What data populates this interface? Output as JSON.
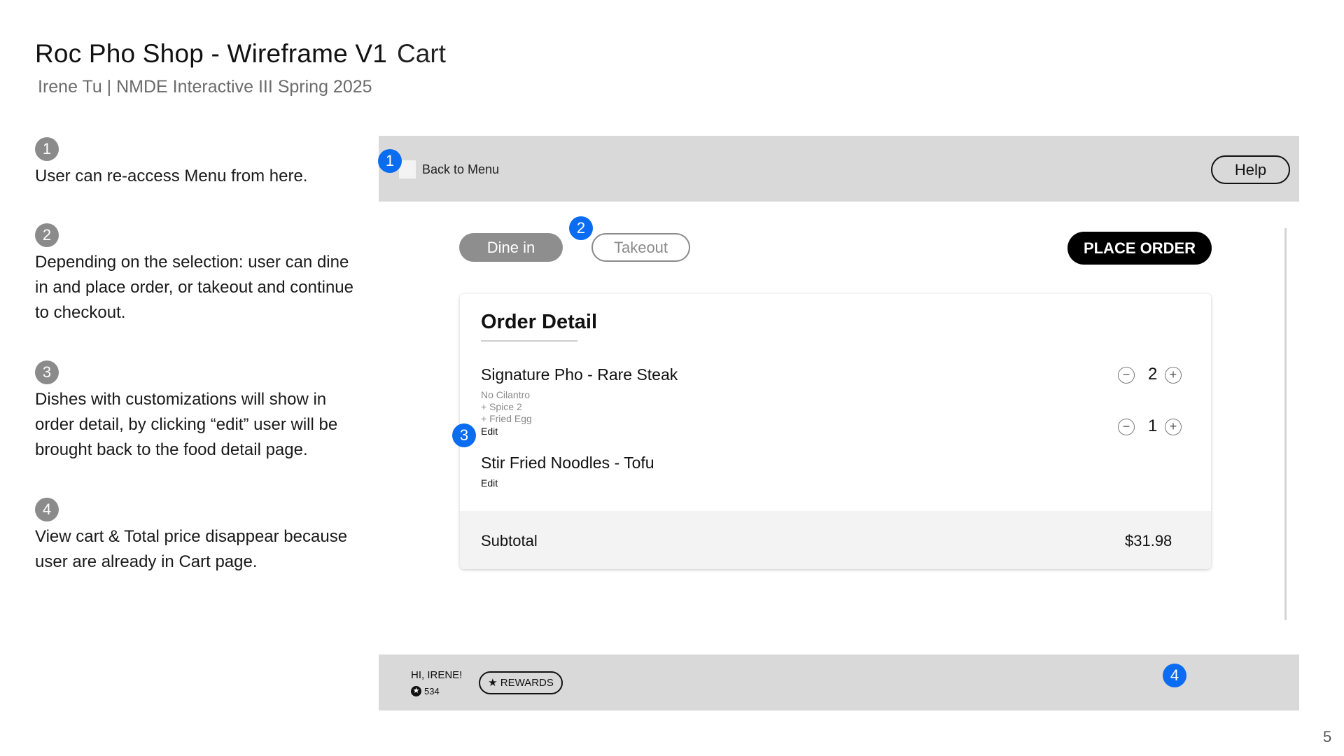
{
  "header": {
    "title": "Roc Pho Shop - Wireframe V1",
    "page_name": "Cart",
    "subtitle": "Irene Tu | NMDE Interactive III Spring 2025"
  },
  "notes": [
    {
      "num": "1",
      "text": "User can re-access Menu from here."
    },
    {
      "num": "2",
      "text": "Depending on the selection: user can dine in and place order, or takeout and continue to checkout."
    },
    {
      "num": "3",
      "text": "Dishes with customizations will show in order detail, by clicking “edit” user will be brought back to the food detail page."
    },
    {
      "num": "4",
      "text": "View cart & Total price disappear because user are already in Cart page."
    }
  ],
  "app": {
    "top_bar": {
      "back_label": "Back to Menu",
      "help_label": "Help"
    },
    "markers": [
      "1",
      "2",
      "3",
      "4"
    ],
    "order_type": {
      "dine_in": "Dine in",
      "takeout": "Takeout",
      "selected": "Dine in"
    },
    "place_order_label": "PLACE ORDER",
    "order_detail": {
      "title": "Order Detail",
      "items": [
        {
          "name": "Signature Pho - Rare Steak",
          "modifiers": [
            "No Cilantro",
            "+ Spice 2",
            "+ Fried Egg"
          ],
          "edit_label": "Edit",
          "qty": "2"
        },
        {
          "name": "Stir Fried Noodles - Tofu",
          "modifiers": [],
          "edit_label": "Edit",
          "qty": "1"
        }
      ],
      "subtotal_label": "Subtotal",
      "subtotal_amount": "$31.98"
    },
    "bottom_bar": {
      "greeting": "HI, IRENE!",
      "points": "534",
      "rewards_label": "REWARDS"
    }
  },
  "page_number": "5",
  "colors": {
    "marker_blue": "#0a6cf0",
    "bar_gray": "#d9d9d9",
    "note_number_gray": "#8b8b8b"
  }
}
